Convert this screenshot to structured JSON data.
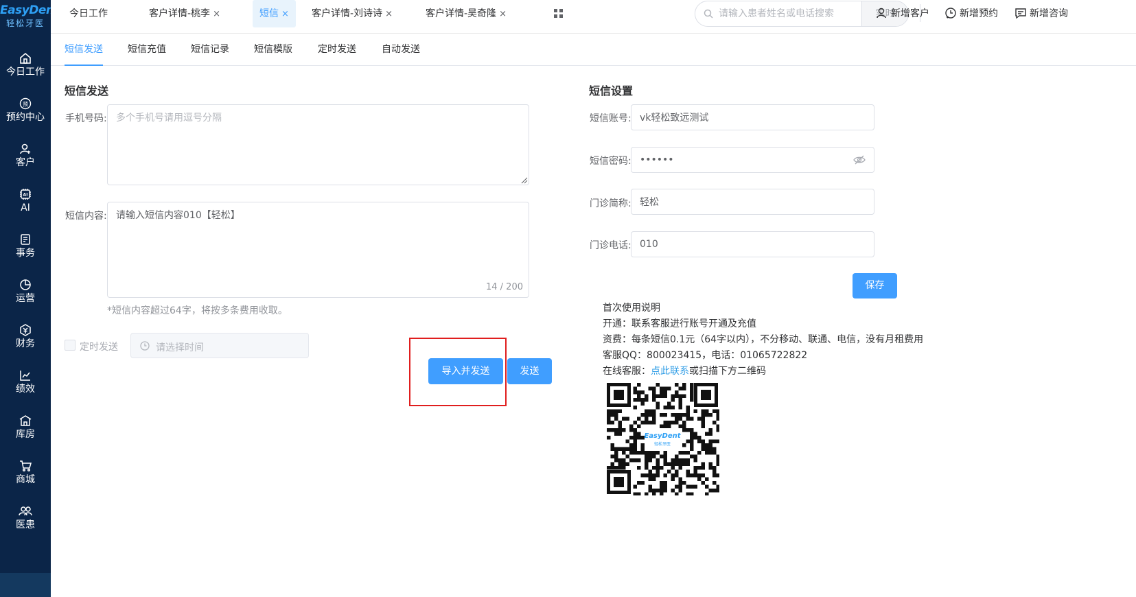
{
  "sidebar": {
    "logo_main": "EasyDent",
    "logo_sub": "轻松牙医",
    "items": [
      {
        "label": "今日工作",
        "icon": "home-icon"
      },
      {
        "label": "预约中心",
        "icon": "appointment-icon"
      },
      {
        "label": "客户",
        "icon": "customer-icon"
      },
      {
        "label": "AI",
        "icon": "ai-chip-icon"
      },
      {
        "label": "事务",
        "icon": "task-icon"
      },
      {
        "label": "运营",
        "icon": "pie-chart-icon"
      },
      {
        "label": "财务",
        "icon": "finance-icon"
      },
      {
        "label": "绩效",
        "icon": "trend-chart-icon"
      },
      {
        "label": "库房",
        "icon": "warehouse-icon"
      },
      {
        "label": "商城",
        "icon": "cart-icon"
      },
      {
        "label": "医患",
        "icon": "doctor-patient-icon"
      }
    ]
  },
  "topbar": {
    "tabs": [
      {
        "label": "今日工作",
        "closable": false
      },
      {
        "label": "客户详情-桃李",
        "closable": true
      },
      {
        "label": "短信",
        "closable": true,
        "active": true
      },
      {
        "label": "客户详情-刘诗诗",
        "closable": true
      },
      {
        "label": "客户详情-吴奇隆",
        "closable": true
      }
    ],
    "close_glyph": "×",
    "search_placeholder": "请输入患者姓名或电话搜索",
    "realtime_label": "实时",
    "actions": {
      "new_customer": "新增客户",
      "new_appointment": "新增预约",
      "new_consult": "新增咨询"
    }
  },
  "subtabs": [
    "短信发送",
    "短信充值",
    "短信记录",
    "短信模版",
    "定时发送",
    "自动发送"
  ],
  "send_panel": {
    "title": "短信发送",
    "phone_label": "手机号码:",
    "phone_placeholder": "多个手机号请用逗号分隔",
    "content_label": "短信内容:",
    "content_value": "请输入短信内容010【轻松】",
    "counter": "14 / 200",
    "hint": "*短信内容超过64字，将按多条费用收取。",
    "schedule_label": "定时发送",
    "time_placeholder": "请选择时间",
    "import_send_label": "导入并发送",
    "send_label": "发送"
  },
  "settings_panel": {
    "title": "短信设置",
    "account_label": "短信账号:",
    "account_value": "vk轻松致远测试",
    "password_label": "短信密码:",
    "password_value": "••••••",
    "clinic_short_label": "门诊简称:",
    "clinic_short_value": "轻松",
    "clinic_phone_label": "门诊电话:",
    "clinic_phone_value": "010",
    "save_label": "保存"
  },
  "instructions": {
    "heading": "首次使用说明",
    "activate": "开通：联系客服进行账号开通及充值",
    "fee": "资费：每条短信0.1元（64字以内），不分移动、联通、电信，没有月租费用",
    "contact": "客服QQ：800023415，电话：01065722822",
    "online_prefix": "在线客服：",
    "online_link": "点此联系",
    "online_suffix": "或扫描下方二维码",
    "qr_logo_text": "EasyDent",
    "qr_logo_sub": "轻松牙医"
  },
  "colors": {
    "sidebar_bg": "#0b2548",
    "accent": "#409eff",
    "highlight": "#e01e1e",
    "link": "#2d9ce6"
  }
}
